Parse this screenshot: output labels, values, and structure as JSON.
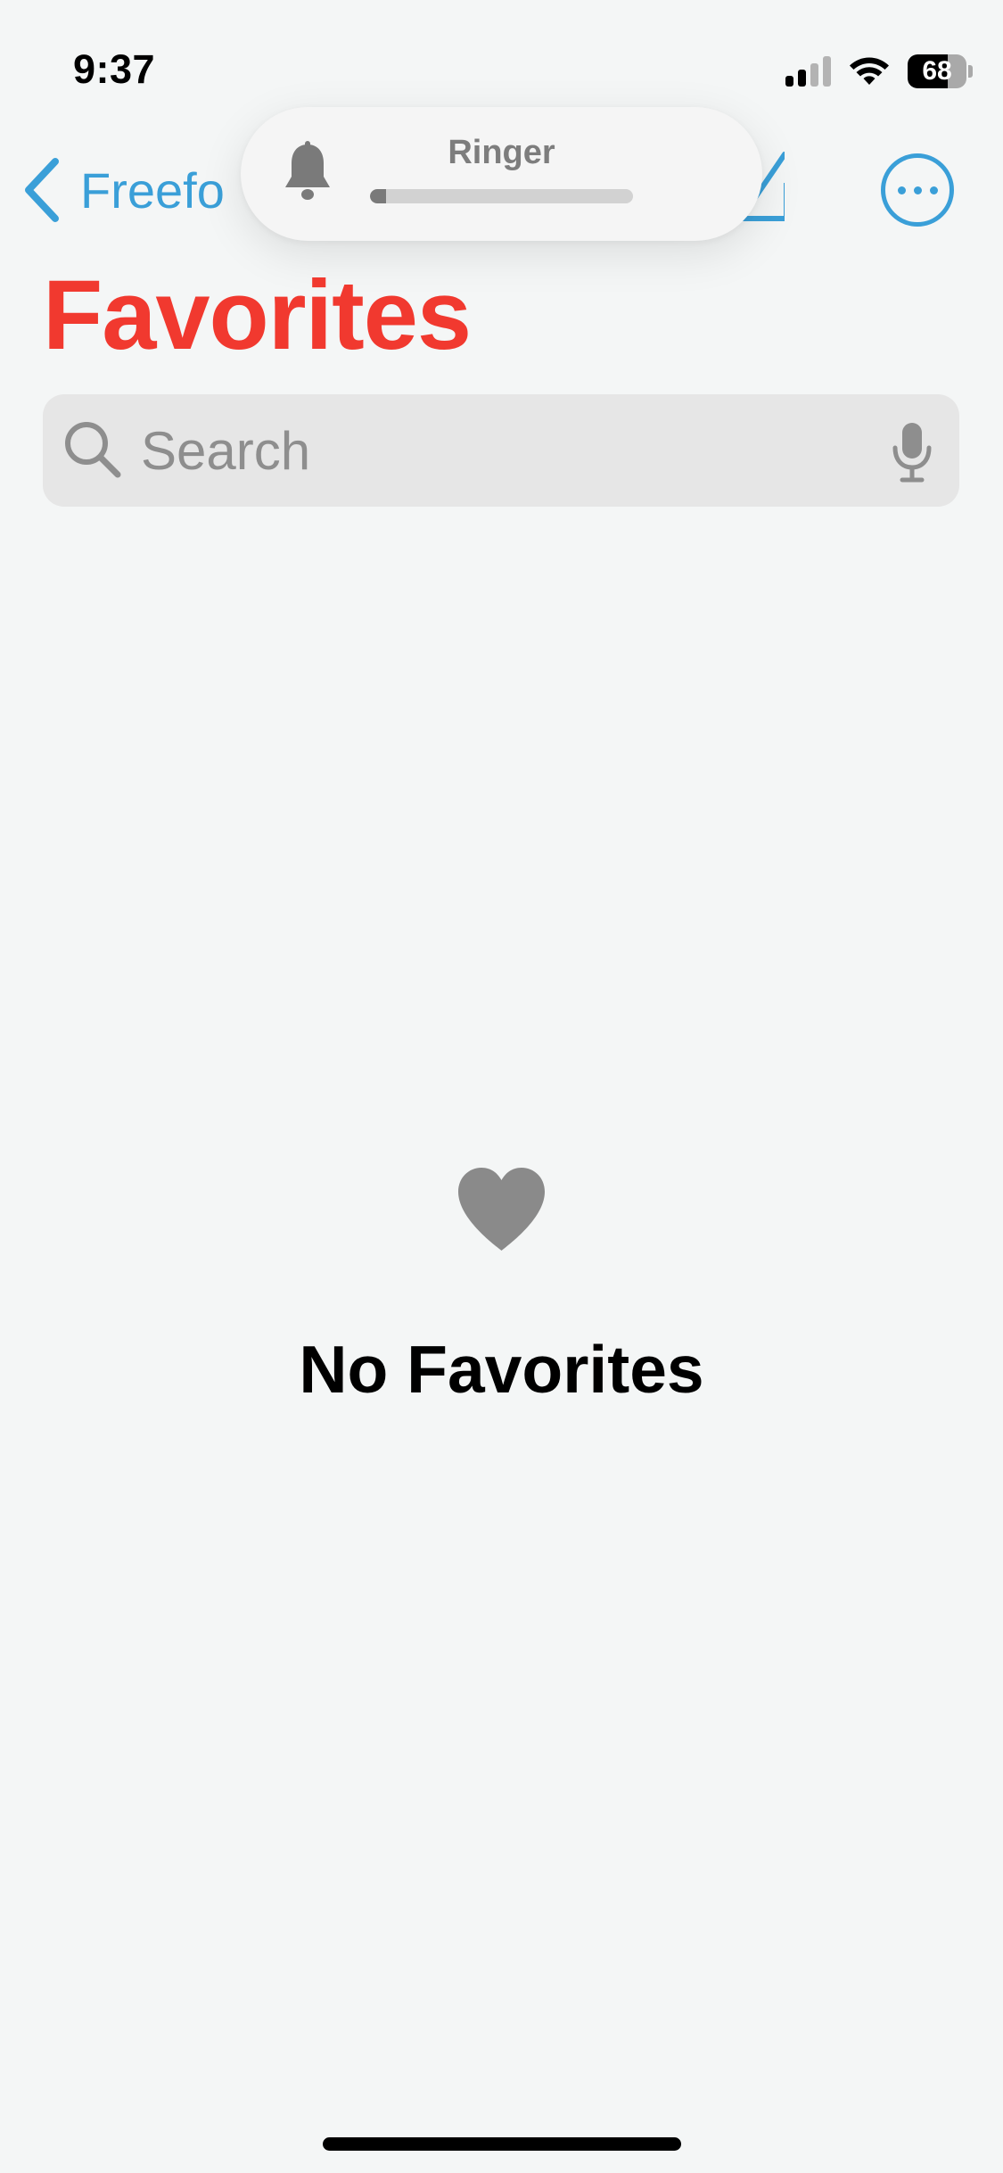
{
  "status_bar": {
    "time": "9:37",
    "battery_level": 68,
    "battery_text": "68",
    "signal_bars_active": 2,
    "signal_bars_total": 4
  },
  "nav": {
    "back_label": "Freefo",
    "back_icon": "chevron-left-icon",
    "compose_icon": "compose-icon",
    "more_icon": "ellipsis-circle-icon"
  },
  "ringer": {
    "label": "Ringer",
    "level": 0.06,
    "icon": "bell-icon"
  },
  "page": {
    "title": "Favorites"
  },
  "search": {
    "placeholder": "Search",
    "value": ""
  },
  "empty_state": {
    "icon": "heart-icon",
    "title": "No Favorites"
  },
  "colors": {
    "accent": "#3a9fd8",
    "title": "#f1392f",
    "background": "#f4f6f6"
  }
}
